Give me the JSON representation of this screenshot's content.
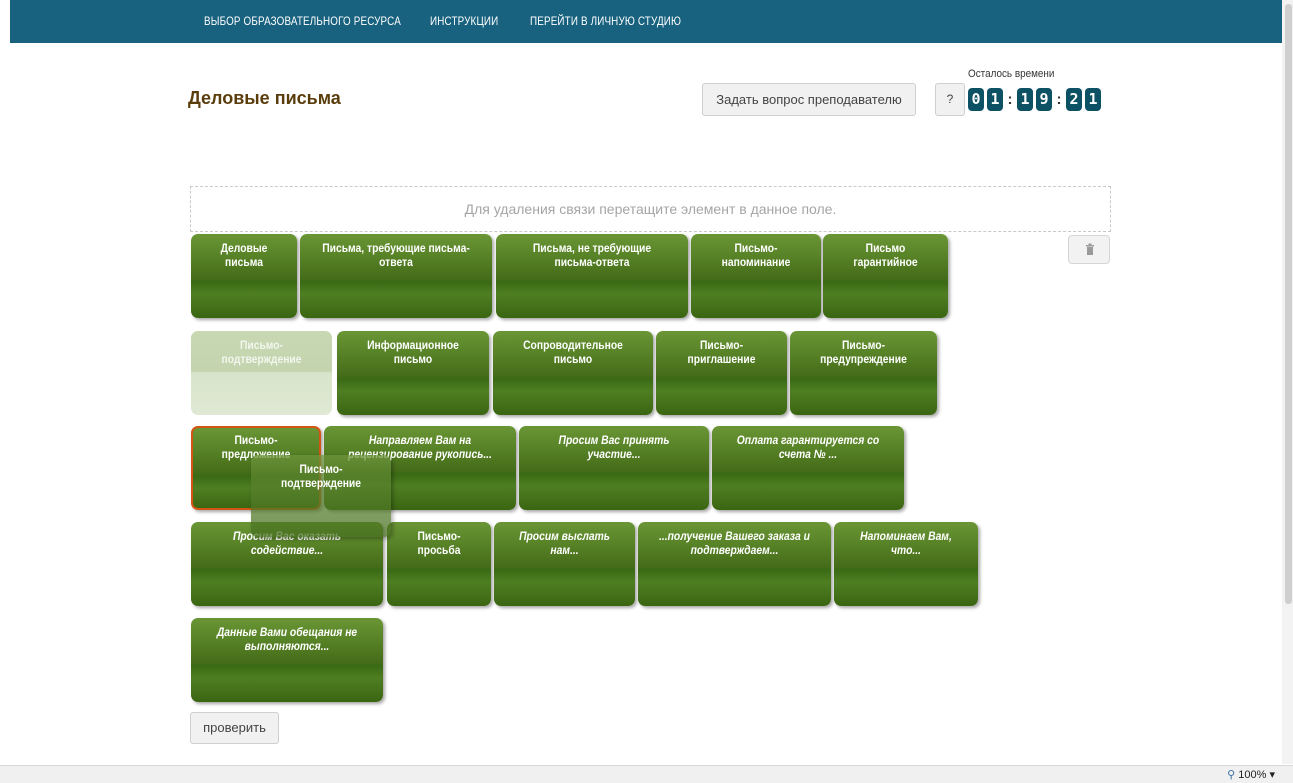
{
  "nav": {
    "items": [
      "ВЫБОР ОБРАЗОВАТЕЛЬНОГО РЕСУРСА",
      "ИНСТРУКЦИИ",
      "ПЕРЕЙТИ В ЛИЧНУЮ СТУДИЮ"
    ]
  },
  "header": {
    "title": "Деловые письма",
    "ask_button": "Задать вопрос преподавателю",
    "help_button": "?",
    "timer_label": "Осталось времени",
    "timer_digits": [
      "0",
      "1",
      "1",
      "9",
      "2",
      "1"
    ],
    "timer_separator": ":"
  },
  "dropzone": {
    "text": "Для удаления связи перетащите элемент в данное поле."
  },
  "trash_icon": "trash-icon",
  "cards": [
    "Деловые письма",
    "Письма, требующие письма-ответа",
    "Письма, не требующие письма-ответа",
    "Письмо-напоминание",
    "Письмо гарантийное",
    "Письмо-подтверждение",
    "Информационное письмо",
    "Сопроводительное письмо",
    "Письмо-приглашение",
    "Письмо-предупреждение",
    "Письмо-предложение",
    "Направляем Вам на рецензирование рукопись...",
    "Просим Вас принять участие...",
    "Оплата гарантируется со счета № ...",
    "Просим Вас оказать содействие...",
    "Письмо-просьба",
    "Просим выслать нам...",
    "...получение Вашего заказа и подтверждаем...",
    "Напоминаем Вам, что...",
    "Данные Вами обещания не выполняются..."
  ],
  "dragging_card": "Письмо-подтверждение",
  "check_button": "проверить",
  "status": {
    "zoom": "100%"
  },
  "colors": {
    "nav_bg": "#18627f",
    "card_green": "#4f7e22",
    "timer_digit_bg": "#0d5164",
    "selected_border": "#d25514",
    "title_color": "#5a3d0c"
  }
}
